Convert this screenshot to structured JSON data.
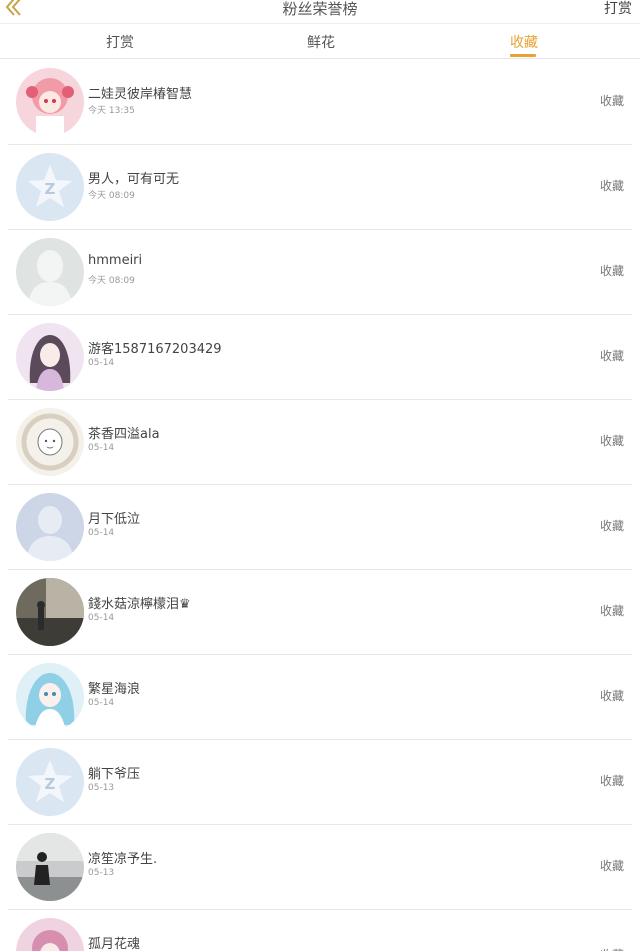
{
  "header": {
    "title": "粉丝荣誉榜",
    "right_label": "打赏",
    "back_icon": "chevron-double-left-icon"
  },
  "tabs": [
    {
      "label": "打赏",
      "active": false
    },
    {
      "label": "鲜花",
      "active": false
    },
    {
      "label": "收藏",
      "active": true
    }
  ],
  "accent_color": "#e8a233",
  "users": [
    {
      "name": "二娃灵彼岸椿智慧",
      "time": "今天 13:35",
      "action": "收藏",
      "avatar": "anime-girl-pink-avatar"
    },
    {
      "name": "男人，可有可无",
      "time": "今天 08:09",
      "action": "收藏",
      "avatar": "qq-default-avatar"
    },
    {
      "name": "hmmeiri",
      "time": "今天 08:09",
      "action": "收藏",
      "avatar": "default-silhouette-avatar"
    },
    {
      "name": "游客1587167203429",
      "time": "05-14",
      "action": "收藏",
      "avatar": "anime-girl-purple-avatar"
    },
    {
      "name": "茶香四溢ala",
      "time": "05-14",
      "action": "收藏",
      "avatar": "sketch-character-avatar"
    },
    {
      "name": "月下低泣",
      "time": "05-14",
      "action": "收藏",
      "avatar": "default-person-avatar"
    },
    {
      "name": "錢水菇涼檸檬泪♛",
      "time": "05-14",
      "action": "收藏",
      "avatar": "photo-dark-avatar"
    },
    {
      "name": "繁星海浪",
      "time": "05-14",
      "action": "收藏",
      "avatar": "anime-girl-blue-avatar"
    },
    {
      "name": "躺下爷压",
      "time": "05-13",
      "action": "收藏",
      "avatar": "qq-default-avatar"
    },
    {
      "name": "凉笙凉予生.",
      "time": "05-13",
      "action": "收藏",
      "avatar": "photo-bw-avatar"
    },
    {
      "name": "孤月花魂",
      "time": "",
      "action": "收藏",
      "avatar": "anime-girl-pink-avatar"
    }
  ]
}
